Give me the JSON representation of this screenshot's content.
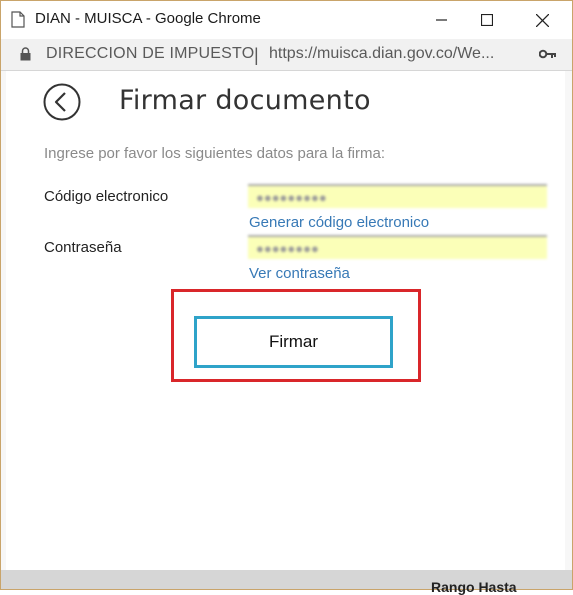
{
  "window": {
    "title": "DIAN - MUISCA - Google Chrome"
  },
  "addressbar": {
    "site_name": "DIRECCION DE IMPUESTO",
    "separator": "|",
    "url": "https://muisca.dian.gov.co/We..."
  },
  "page": {
    "title": "Firmar documento",
    "instructions": "Ingrese por favor los siguientes datos para la firma:",
    "fields": {
      "code_label": "Código electronico",
      "code_value": "●●●●●●●●●",
      "generate_link": "Generar código electronico",
      "password_label": "Contraseña",
      "password_value": "●●●●●●●●",
      "show_password_link": "Ver contraseña"
    },
    "submit_label": "Firmar"
  },
  "background": {
    "partial_text": "Rango Hasta"
  },
  "colors": {
    "link": "#3779b6",
    "input_bg": "#fbffb8",
    "highlight": "#d9262a",
    "button_border": "#2fa3c9"
  }
}
